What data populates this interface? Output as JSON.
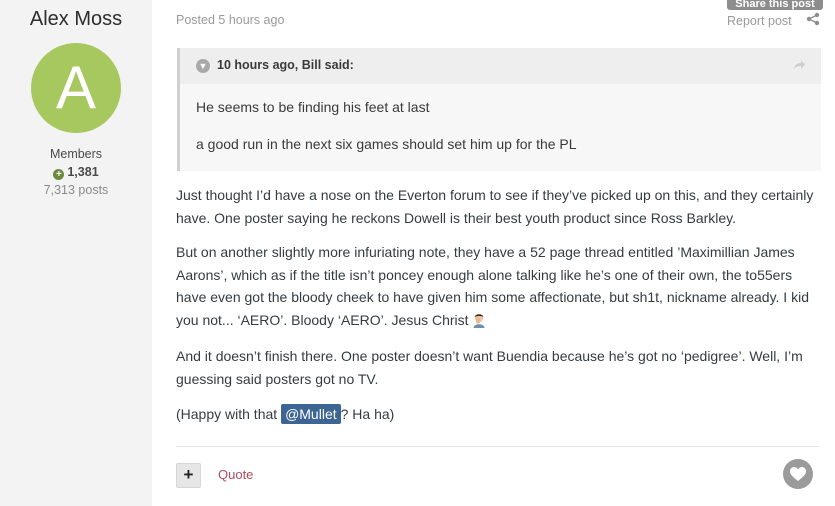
{
  "author": {
    "name": "Alex Moss",
    "avatar_letter": "A",
    "avatar_color": "#a7c75f",
    "group": "Members",
    "reputation": "1,381",
    "posts": "7,313 posts"
  },
  "post_meta": {
    "posted": "Posted 5 hours ago",
    "share_tab": "Share this post",
    "report": "Report post"
  },
  "quote": {
    "citation": "10 hours ago, Bill said:",
    "lines": [
      "He seems to be finding his feet at last",
      "a good run in the next six games should set him up for the PL"
    ]
  },
  "body": {
    "p1": "Just thought I’d have a nose on the Everton forum to see if they’ve picked up on this, and they certainly have. One poster saying he reckons Dowell is their best youth product since Ross Barkley.",
    "p2": "But on another slightly more infuriating note, they have a 52 page thread entitled ’Maximillian James Aarons’, which as if the title isn’t poncey enough alone talking like he’s one of their own, the to55ers have even got the bloody cheek to have given him some affectionate, but sh1t, nickname already. I kid you not... ‘AERO’. Bloody ‘AERO’. Jesus Christ",
    "p3": "And it doesn’t finish there. One poster doesn’t want Buendia because he’s got no ‘pedigree’. Well, I’m guessing said posters got no TV.",
    "p4_before": "(Happy with that ",
    "p4_mention": "@Mullet",
    "p4_after": "? Ha ha)"
  },
  "footer": {
    "multiquote": "+",
    "quote_label": "Quote"
  },
  "icons": {
    "reputation": "plus-circle-icon",
    "share": "share-icon",
    "quote_toggle": "chevron-down-icon",
    "quote_jump": "share-arrow-icon",
    "emoji": "facepalm-emoji-icon",
    "reaction": "heart-icon"
  },
  "colors": {
    "accent_link": "#b24b5e",
    "mention_bg": "#3d6594",
    "sidebar_bg": "#f3f3f3"
  }
}
